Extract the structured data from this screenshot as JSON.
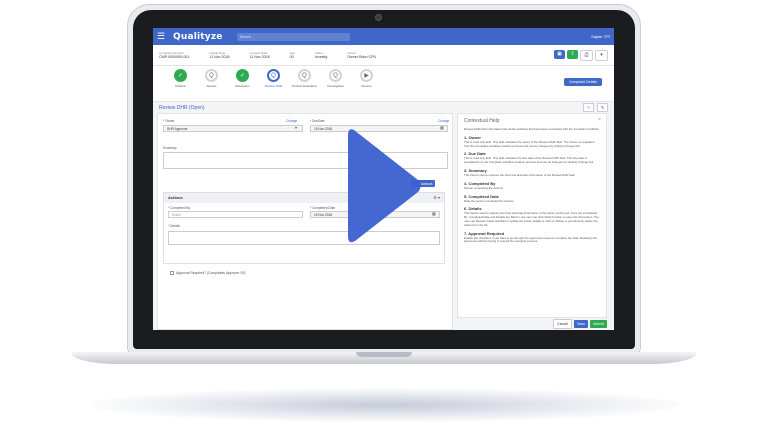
{
  "app": {
    "brand": "Qualityze",
    "search_label": "Search",
    "user_label": "Sapler TPI"
  },
  "info": [
    {
      "label": "Complaint Number",
      "value": "CMP-0000000-001"
    },
    {
      "label": "Initiate Date",
      "value": "11 Nov 2018"
    },
    {
      "label": "Created Date",
      "value": "11 Nov 2018"
    },
    {
      "label": "Age",
      "value": "00"
    },
    {
      "label": "Status",
      "value": "Investig"
    },
    {
      "label": "Owner",
      "value": "Owner Robo CPU"
    }
  ],
  "steps": [
    {
      "label": "Initiation",
      "icon": "✓"
    },
    {
      "label": "Review",
      "icon": "Q"
    },
    {
      "label": "Resolution",
      "icon": "✓"
    },
    {
      "label": "Review DHR",
      "icon": "Q"
    },
    {
      "label": "Product Evaluation",
      "icon": "Q"
    },
    {
      "label": "Investigation",
      "icon": "Q"
    },
    {
      "label": "Closure",
      "icon": "▶"
    }
  ],
  "complaint_details_button": "Complaint Details",
  "page_title": "Review DHR (Open)",
  "form": {
    "owner_label": "* Owner",
    "owner_change": "Change",
    "owner_value": "DHR Approver",
    "due_label": "* DueDate",
    "due_change": "Change",
    "due_value": "15 Nov 2018",
    "summary_label": "Summary",
    "add_actions": "Add Actions",
    "actions_title": "Actions",
    "completed_by_label": "* Completed By",
    "completed_by_placeholder": "Select",
    "completed_date_label": "* Completed Date",
    "completed_date_value": "15 Nov 2018",
    "details_label": "* Details",
    "approval_label": "Approval Required? (Complaints Approver 00)"
  },
  "help": {
    "title": "Contextual Help",
    "intro": "Review DHR task information lists all the activities that have been completed with the Complaint workflow.",
    "sections": [
      {
        "heading": "1. Owner",
        "text": "This is read only field. This field indicates the owner of the Review DHR Task. The Owner is populated from the Complaint workflow creation process and can be changed by clicking Change link."
      },
      {
        "heading": "2. Due Date",
        "text": "This is read only field. This field indicates the due date of the Review DHR Task. The due date is populated from the Complaint workflow creation process and can be changed by clicking Change link."
      },
      {
        "heading": "3. Summary",
        "text": "This field is used to capture the brief and accurate information of the Review DHR task."
      },
      {
        "heading": "4. Completed By",
        "text": "Person completing the Actions."
      },
      {
        "heading": "5. Completed Date",
        "text": "Date the person completed the Actions."
      },
      {
        "heading": "6. Details",
        "text": "This field is used to capture brief and accurate information of the Action performed. Once the Completed By, Completed Date and Details are filled in, the user can click Submit button to save the information. The user can Reopen Tasks and Edit to update the Action details or click on Delete to permanently delete the action from the list."
      },
      {
        "heading": "7. Approval Required",
        "text": "Enable this checkbox if you want to go through the approval process to complete the Task. Reassign the approvers without having to resend the complete process."
      }
    ]
  },
  "footer": {
    "cancel": "Cancel",
    "save": "Save",
    "submit": "Submit"
  },
  "colors": {
    "primary": "#3f67c8",
    "success": "#2eaa52",
    "play": "#3b5fd0"
  }
}
